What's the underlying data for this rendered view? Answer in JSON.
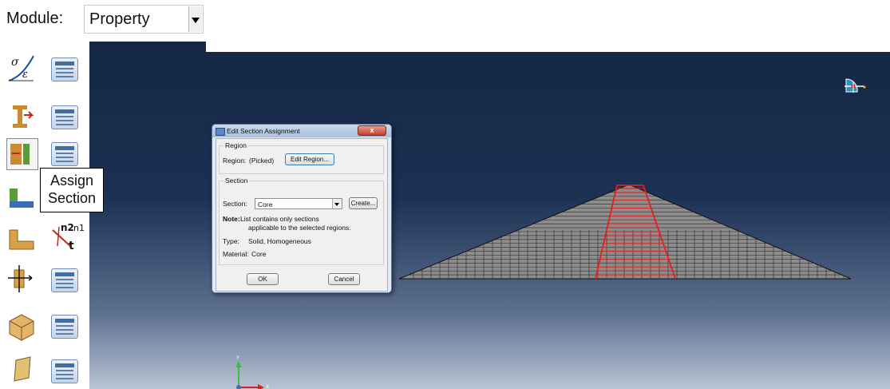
{
  "module": {
    "label": "Module:",
    "value": "Property"
  },
  "tooltip": {
    "line1": "Assign",
    "line2": "Section"
  },
  "toolbox_icons": [
    "material-manager-icon",
    "section-manager-icon",
    "assign-section-icon",
    "beam-section-icon",
    "assign-orientation-icon",
    "assign-beam-orientation-icon",
    "skin-icon",
    "composite-layup-icon",
    "special-icon"
  ],
  "dialog": {
    "title": "Edit Section Assignment",
    "close_symbol": "x",
    "region_group": "Region",
    "region_label": "Region:",
    "region_value": "(Picked)",
    "edit_region_button": "Edit Region...",
    "section_group": "Section",
    "section_label": "Section:",
    "section_value": "Core",
    "create_button": "Create...",
    "note_label": "Note:",
    "note_line1": "List contains only sections",
    "note_line2": "applicable to the selected regions.",
    "type_label": "Type:",
    "type_value": "Solid, Homogeneous",
    "material_label": "Material:",
    "material_value": "Core",
    "ok_button": "OK",
    "cancel_button": "Cancel"
  },
  "triad": {
    "x": "X",
    "y": "Y"
  },
  "colors": {
    "viewport_top": "#142744",
    "viewport_bottom": "#b9c4d4",
    "mesh_fill": "#8c8c8c",
    "core_highlight": "#e0201c"
  }
}
